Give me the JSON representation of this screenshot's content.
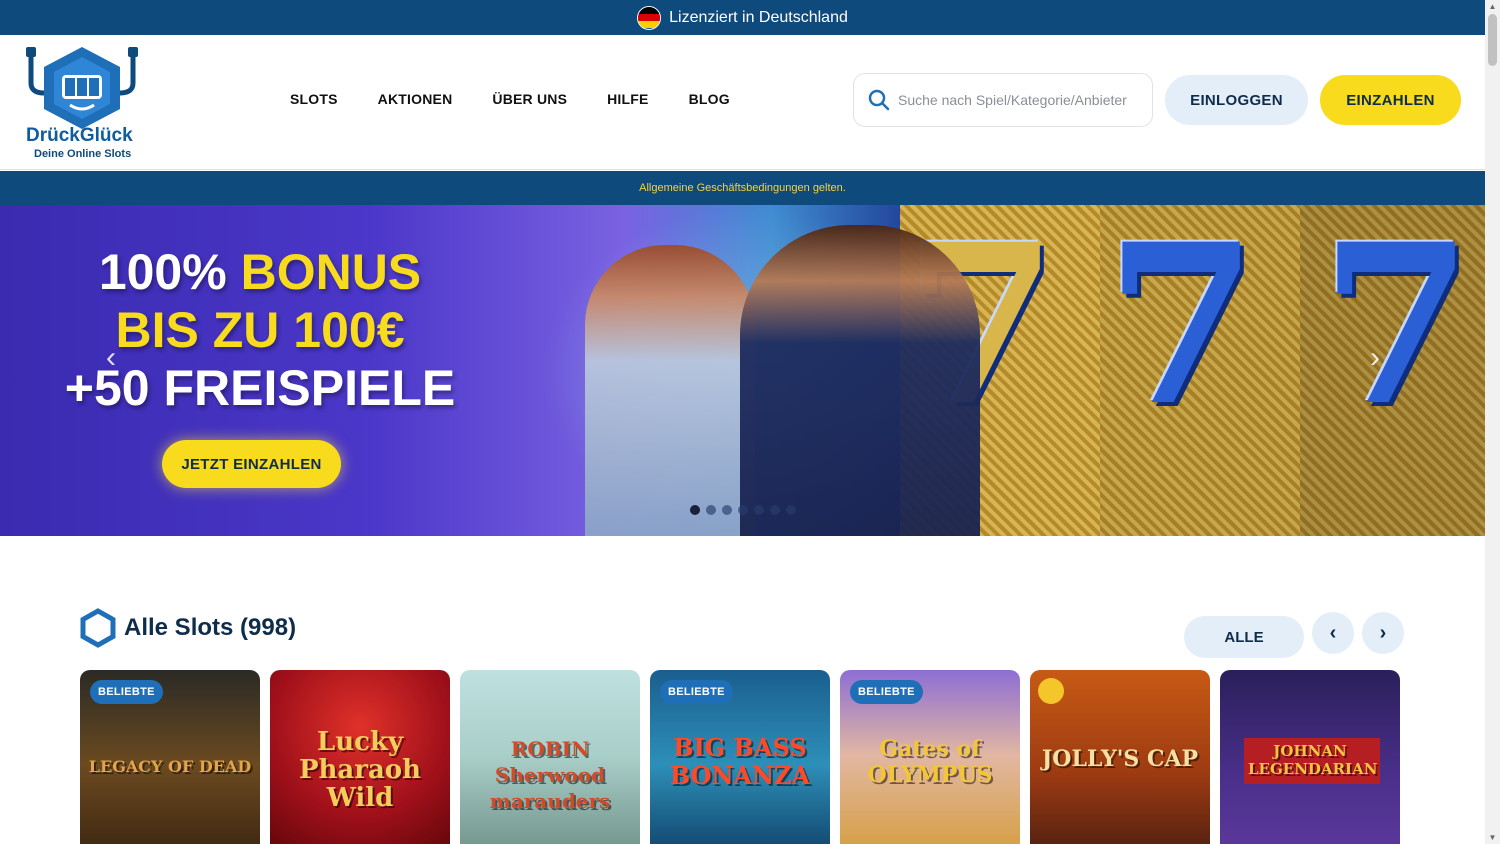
{
  "license_bar": {
    "text": "Lizenziert in Deutschland"
  },
  "logo": {
    "name": "DrückGlück",
    "tagline": "Deine Online Slots",
    "reel_text": "777"
  },
  "nav": {
    "items": [
      {
        "label": "SLOTS"
      },
      {
        "label": "AKTIONEN"
      },
      {
        "label": "ÜBER UNS"
      },
      {
        "label": "HILFE"
      },
      {
        "label": "BLOG"
      }
    ]
  },
  "search": {
    "placeholder": "Suche nach Spiel/Kategorie/Anbieter",
    "icon": "search-icon"
  },
  "auth": {
    "login_label": "EINLOGGEN",
    "deposit_label": "EINZAHLEN"
  },
  "terms": {
    "text": "Allgemeine Geschäftsbedingungen gelten."
  },
  "hero": {
    "line1_a": "100% ",
    "line1_b": "BONUS",
    "line2": "BIS ZU 100€",
    "line3": "+50 FREISPIELE",
    "cta_label": "JETZT EINZAHLEN",
    "slide_count": 7,
    "active_slide": 1,
    "seven": "7"
  },
  "slots": {
    "title": "Alle Slots (998)",
    "filter_label": "ALLE",
    "prev_icon": "‹",
    "next_icon": "›",
    "games": [
      {
        "title": "LEGACY OF DEAD",
        "badge": "BELIEBTE"
      },
      {
        "title": "Lucky Pharaoh Wild",
        "badge": ""
      },
      {
        "title": "ROBIN Sherwood marauders",
        "badge": ""
      },
      {
        "title": "BIG BASS BONANZA",
        "badge": "BELIEBTE"
      },
      {
        "title": "Gates of OLYMPUS",
        "badge": "BELIEBTE"
      },
      {
        "title": "JOLLY'S CAP",
        "badge": ""
      },
      {
        "title": "JOHNAN LEGENDARIAN",
        "badge": ""
      }
    ]
  },
  "colors": {
    "navy": "#0f4a7c",
    "yellow": "#f7db1c",
    "light_blue": "#e4eef8"
  }
}
